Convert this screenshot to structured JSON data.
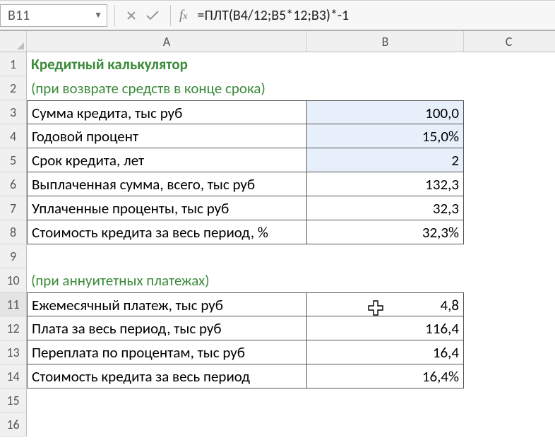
{
  "name_box": "B11",
  "formula": "=ПЛТ(B4/12;B5*12;B3)*-1",
  "columns": [
    "A",
    "B",
    "C"
  ],
  "row_count": 16,
  "active_cell": {
    "row": 11,
    "col": "B"
  },
  "rows": {
    "1": {
      "A": "Кредитный калькулятор"
    },
    "2": {
      "A": "(при возврате средств в конце срока)"
    },
    "3": {
      "A": "Сумма кредита, тыс руб",
      "B": "100,0"
    },
    "4": {
      "A": "Годовой процент",
      "B": "15,0%"
    },
    "5": {
      "A": "Срок кредита, лет",
      "B": "2"
    },
    "6": {
      "A": "Выплаченная сумма, всего, тыс руб",
      "B": "132,3"
    },
    "7": {
      "A": "Уплаченные проценты, тыс руб",
      "B": "32,3"
    },
    "8": {
      "A": "Стоимость кредита за весь период, %",
      "B": "32,3%"
    },
    "10": {
      "A": "(при аннуитетных платежах)"
    },
    "11": {
      "A": "Ежемесячный платеж, тыс руб",
      "B": "4,8"
    },
    "12": {
      "A": "Плата за весь период, тыс руб",
      "B": "116,4"
    },
    "13": {
      "A": "Переплата по процентам, тыс руб",
      "B": "16,4"
    },
    "14": {
      "A": "Стоимость кредита за весь период",
      "B": "16,4%"
    }
  }
}
